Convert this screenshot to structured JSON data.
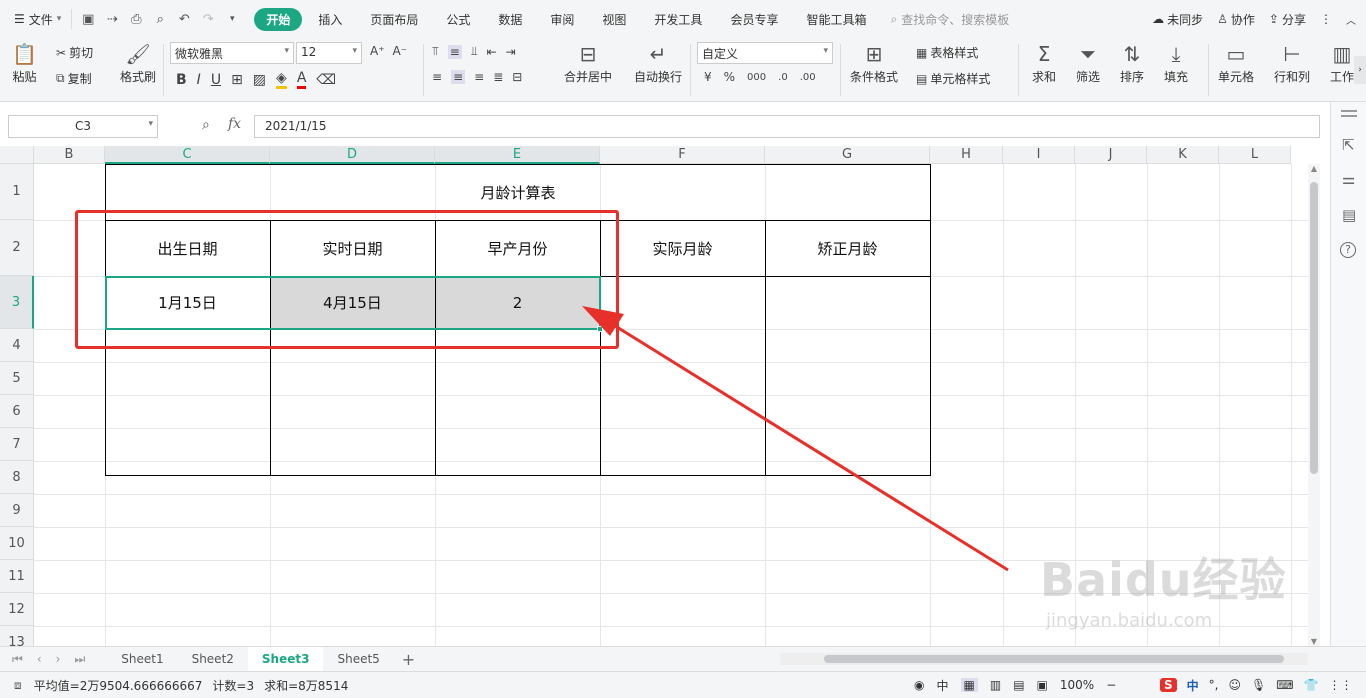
{
  "menubar": {
    "file_label": "文件",
    "tabs": [
      "开始",
      "插入",
      "页面布局",
      "公式",
      "数据",
      "审阅",
      "视图",
      "开发工具",
      "会员专享",
      "智能工具箱"
    ],
    "active_tab": "开始",
    "search_placeholder": "查找命令、搜索模板",
    "sync_label": "未同步",
    "collab_label": "协作",
    "share_label": "分享"
  },
  "ribbon": {
    "paste": "粘贴",
    "cut": "剪切",
    "copy": "复制",
    "format_painter": "格式刷",
    "font_name": "微软雅黑",
    "font_size": "12",
    "merge_center": "合并居中",
    "wrap_text": "自动换行",
    "number_format": "自定义",
    "conditional_format": "条件格式",
    "table_style": "表格样式",
    "cell_style": "单元格样式",
    "sum": "求和",
    "filter": "筛选",
    "sort": "排序",
    "fill": "填充",
    "cell": "单元格",
    "row_col": "行和列",
    "worksheet": "工作"
  },
  "formula": {
    "name_box": "C3",
    "fx_label": "fx",
    "value": "2021/1/15"
  },
  "grid": {
    "columns": [
      "B",
      "C",
      "D",
      "E",
      "F",
      "G",
      "H",
      "I",
      "J",
      "K",
      "L"
    ],
    "rows": [
      "1",
      "2",
      "3",
      "4",
      "5",
      "6",
      "7",
      "8",
      "9",
      "10",
      "11",
      "12",
      "13"
    ]
  },
  "table": {
    "title": "月龄计算表",
    "headers": [
      "出生日期",
      "实时日期",
      "早产月份",
      "实际月龄",
      "矫正月龄"
    ],
    "row": [
      "1月15日",
      "4月15日",
      "2",
      "",
      ""
    ]
  },
  "sheets": [
    "Sheet1",
    "Sheet2",
    "Sheet3",
    "Sheet5"
  ],
  "active_sheet": "Sheet3",
  "status": {
    "average": "平均值=2万9504.666666667",
    "count": "计数=3",
    "sum": "求和=8万8514",
    "zoom": "100%"
  },
  "watermark": {
    "brand": "Baidu经验",
    "url": "jingyan.baidu.com"
  },
  "colors": {
    "accent": "#1ba784",
    "annotation": "#e8302a"
  }
}
